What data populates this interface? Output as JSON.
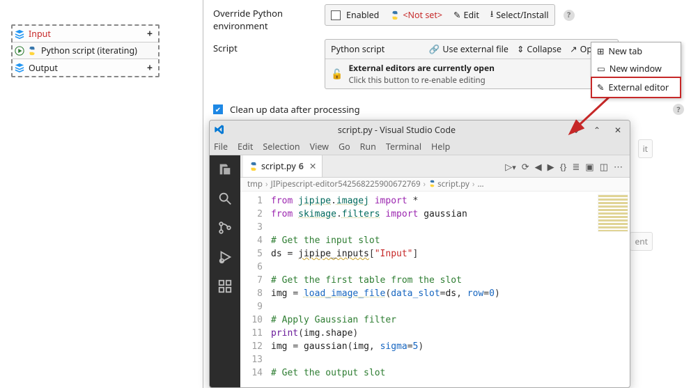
{
  "node": {
    "input_label": "Input",
    "center_label": "Python script (iterating)",
    "output_label": "Output"
  },
  "panel": {
    "override_label": "Override Python environment",
    "enabled_label": "Enabled",
    "notset_label": "<Not set>",
    "edit_label": "Edit",
    "select_label": "Select/Install",
    "script_label": "Script",
    "script_title": "Python script",
    "use_external_label": "Use external file",
    "collapse_label": "Collapse",
    "openin_label": "Open in",
    "ext_msg_title": "External editors are currently open",
    "ext_msg_sub": "Click this button to re-enable editing",
    "cleanup_label": "Clean up data after processing"
  },
  "ctx": {
    "new_tab": "New tab",
    "new_window": "New window",
    "ext_editor": "External editor"
  },
  "ghost": {
    "a": "it",
    "b": "ent"
  },
  "vscode": {
    "title": "script.py - Visual Studio Code",
    "menus": [
      "File",
      "Edit",
      "Selection",
      "View",
      "Go",
      "Run",
      "Terminal",
      "Help"
    ],
    "tab_name": "script.py",
    "tab_mod": "6",
    "breadcrumb": [
      "tmp",
      "JIPipescript-editor542568225900672769",
      "script.py",
      "…"
    ],
    "lines": [
      {
        "n": 1,
        "html": "<span class='kw'>from</span> <span class='mod2'>jipipe</span><span class='op'>.</span><span class='mod2'>imagej</span> <span class='kw'>import</span> <span class='op'>*</span>"
      },
      {
        "n": 2,
        "html": "<span class='kw'>from</span> <span class='mod2'>skimage</span><span class='op'>.</span><span class='mod2'>filters</span> <span class='kw'>import</span> <span class='id'>gaussian</span>"
      },
      {
        "n": 3,
        "html": ""
      },
      {
        "n": 4,
        "html": "<span class='cmt'># Get the input slot</span>"
      },
      {
        "n": 5,
        "html": "<span class='id'>ds</span> <span class='op'>=</span> <span class='wavy id'>jipipe_inputs</span><span class='op'>[</span><span class='str'>\"Input\"</span><span class='op'>]</span>"
      },
      {
        "n": 6,
        "html": ""
      },
      {
        "n": 7,
        "html": "<span class='cmt'># Get the first table from the slot</span>"
      },
      {
        "n": 8,
        "html": "<span class='id'>img</span> <span class='op'>=</span> <span class='fnblue'>load_image_file</span><span class='op'>(</span><span class='attr'>data_slot</span><span class='op'>=</span><span class='id'>ds</span><span class='op'>,</span> <span class='attr'>row</span><span class='op'>=</span><span class='num'>0</span><span class='op'>)</span>"
      },
      {
        "n": 9,
        "html": ""
      },
      {
        "n": 10,
        "html": "<span class='cmt'># Apply Gaussian filter</span>"
      },
      {
        "n": 11,
        "html": "<span class='fn'>print</span><span class='op'>(</span><span class='id'>img</span><span class='op'>.</span><span class='id'>shape</span><span class='op'>)</span>"
      },
      {
        "n": 12,
        "html": "<span class='id'>img</span> <span class='op'>=</span> <span class='id'>gaussian</span><span class='op'>(</span><span class='id'>img</span><span class='op'>,</span> <span class='attr'>sigma</span><span class='op'>=</span><span class='num'>5</span><span class='op'>)</span>"
      },
      {
        "n": 13,
        "html": ""
      },
      {
        "n": 14,
        "html": "<span class='cmt'># Get the output slot</span>"
      }
    ]
  }
}
